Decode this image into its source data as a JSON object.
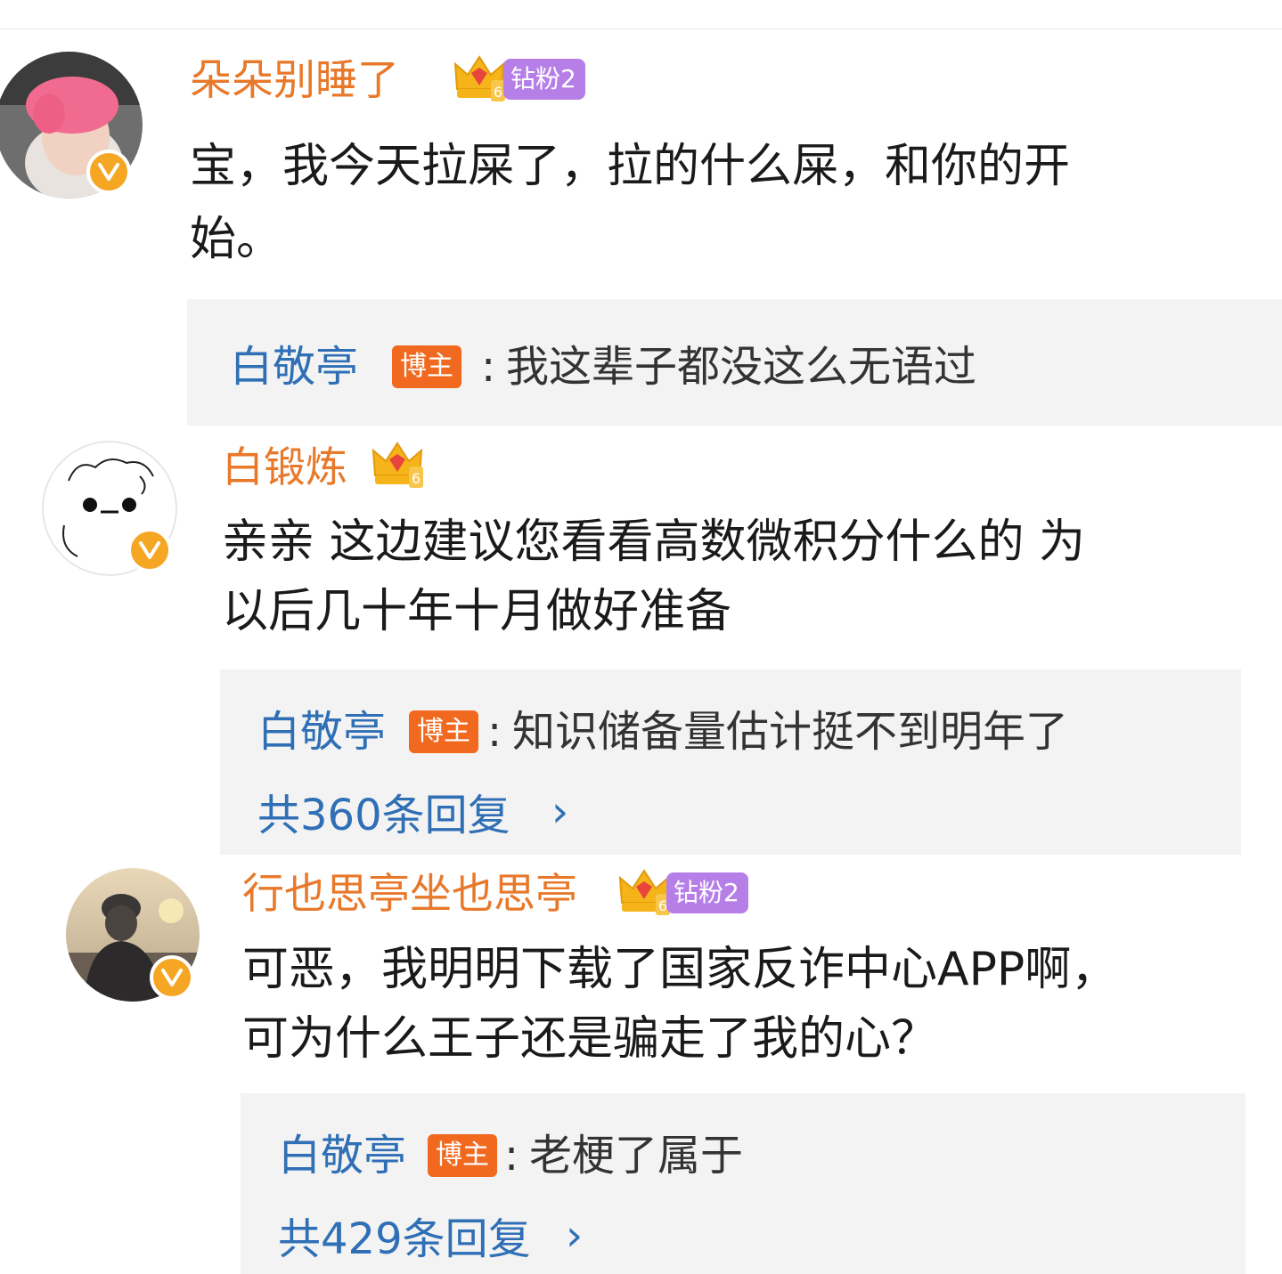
{
  "comments": [
    {
      "username": "朵朵别睡了",
      "fan_badge": "钻粉2",
      "crown_level": "6",
      "text_line1": "宝，我今天拉屎了，拉的什么屎，和你的开",
      "text_line2": "始。",
      "reply": {
        "name": "白敬亭",
        "tag": "博主",
        "separator": ":",
        "text": "我这辈子都没这么无语过"
      }
    },
    {
      "username": "白锻炼",
      "crown_level": "6",
      "text_line1": "亲亲 这边建议您看看高数微积分什么的 为",
      "text_line2": "以后几十年十月做好准备",
      "reply": {
        "name": "白敬亭",
        "tag": "博主",
        "separator": ":",
        "text": "知识储备量估计挺不到明年了",
        "count": "共360条回复",
        "chevron": "›"
      }
    },
    {
      "username": "行也思亭坐也思亭",
      "fan_badge": "钻粉2",
      "crown_level": "6",
      "text_line1": "可恶，我明明下载了国家反诈中心APP啊，",
      "text_line2": "可为什么王子还是骗走了我的心？",
      "reply": {
        "name": "白敬亭",
        "tag": "博主",
        "separator": ":",
        "text": "老梗了属于",
        "count": "共429条回复",
        "chevron": "›"
      }
    }
  ],
  "colors": {
    "username": "#e8782a",
    "reply_name": "#2f6fb5",
    "blogger_tag": "#f0691f",
    "fan_badge": "#b67fe8",
    "verified": "#f5a623",
    "reply_bg": "#f3f3f3"
  },
  "icons": {
    "verified": "verified-v-icon",
    "crown": "crown-icon",
    "chevron": "chevron-right-icon"
  }
}
